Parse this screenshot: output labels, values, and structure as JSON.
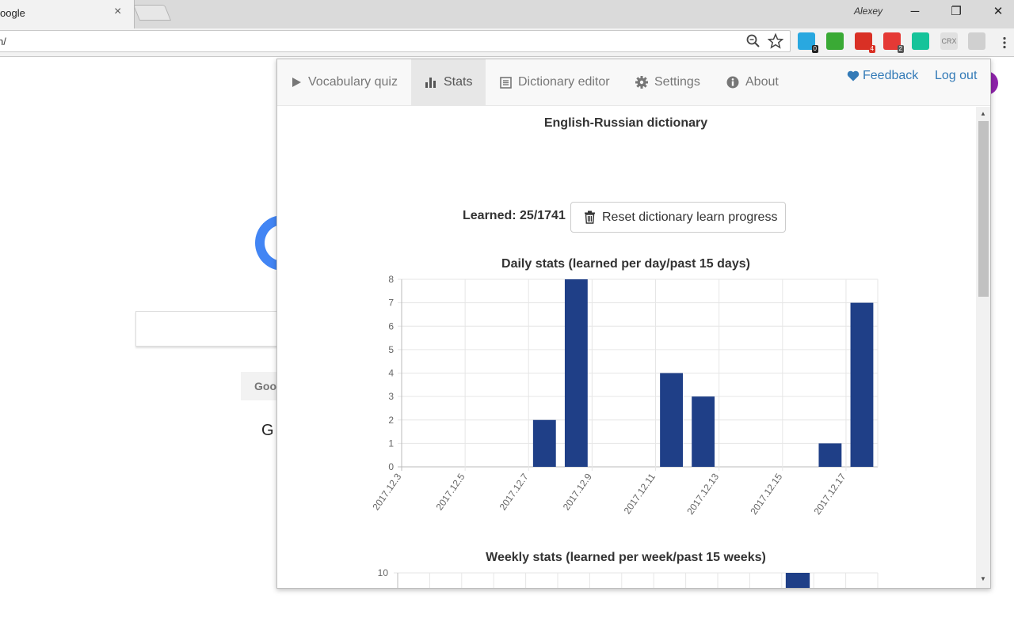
{
  "browser": {
    "tab_title": "oogle",
    "tab_close": "×",
    "user": "Alexey",
    "url": "n/",
    "minimize": "─",
    "restore": "❐",
    "close": "✕",
    "extensions": [
      {
        "name": "ext-1",
        "color": "#29a8e0",
        "badge": "0",
        "badge_color": "#222"
      },
      {
        "name": "ext-2",
        "color": "#3aaa35",
        "badge": "",
        "badge_color": ""
      },
      {
        "name": "ext-3",
        "color": "#d93025",
        "badge": "4",
        "badge_color": "#d93025"
      },
      {
        "name": "ext-4",
        "color": "#e53935",
        "badge": "2",
        "badge_color": "#555"
      },
      {
        "name": "ext-5",
        "color": "#15c39a",
        "badge": "",
        "badge_color": ""
      },
      {
        "name": "ext-crx",
        "color": "#e0e0e0",
        "badge": "",
        "badge_color": ""
      },
      {
        "name": "ext-dictionary",
        "color": "#d0d0d0",
        "badge": "",
        "badge_color": ""
      }
    ],
    "crx_label": "CRX"
  },
  "google": {
    "button_fragment": "Goo",
    "text_fragment": "G"
  },
  "popup": {
    "nav": [
      {
        "key": "quiz",
        "label": "Vocabulary quiz",
        "icon": "play-icon",
        "active": false
      },
      {
        "key": "stats",
        "label": "Stats",
        "icon": "bar-chart-icon",
        "active": true
      },
      {
        "key": "editor",
        "label": "Dictionary editor",
        "icon": "list-icon",
        "active": false
      },
      {
        "key": "settings",
        "label": "Settings",
        "icon": "gear-icon",
        "active": false
      },
      {
        "key": "about",
        "label": "About",
        "icon": "info-icon",
        "active": false
      }
    ],
    "feedback": "Feedback",
    "logout": "Log out",
    "dictionary_title": "English-Russian dictionary",
    "learned": "Learned: 25/1741",
    "reset_button": "Reset dictionary learn progress",
    "accent": "#337ab7"
  },
  "chart_data": [
    {
      "type": "bar",
      "title": "Daily stats (learned per day/past 15 days)",
      "categories": [
        "2017.12.3",
        "2017.12.4",
        "2017.12.5",
        "2017.12.6",
        "2017.12.7",
        "2017.12.8",
        "2017.12.9",
        "2017.12.10",
        "2017.12.11",
        "2017.12.12",
        "2017.12.13",
        "2017.12.14",
        "2017.12.15",
        "2017.12.16",
        "2017.12.17"
      ],
      "tick_labels": [
        "2017.12.3",
        "2017.12.5",
        "2017.12.7",
        "2017.12.9",
        "2017.12.11",
        "2017.12.13",
        "2017.12.15",
        "2017.12.17"
      ],
      "values": [
        0,
        0,
        0,
        0,
        2,
        8,
        0,
        0,
        4,
        3,
        0,
        0,
        0,
        1,
        7
      ],
      "ylim": [
        0,
        8
      ],
      "yticks": [
        0,
        1,
        2,
        3,
        4,
        5,
        6,
        7,
        8
      ],
      "color": "#1f3f87",
      "grid": true
    },
    {
      "type": "bar",
      "title": "Weekly stats (learned per week/past 15 weeks)",
      "ytick_top": "10",
      "color": "#1f3f87",
      "grid": true
    }
  ]
}
